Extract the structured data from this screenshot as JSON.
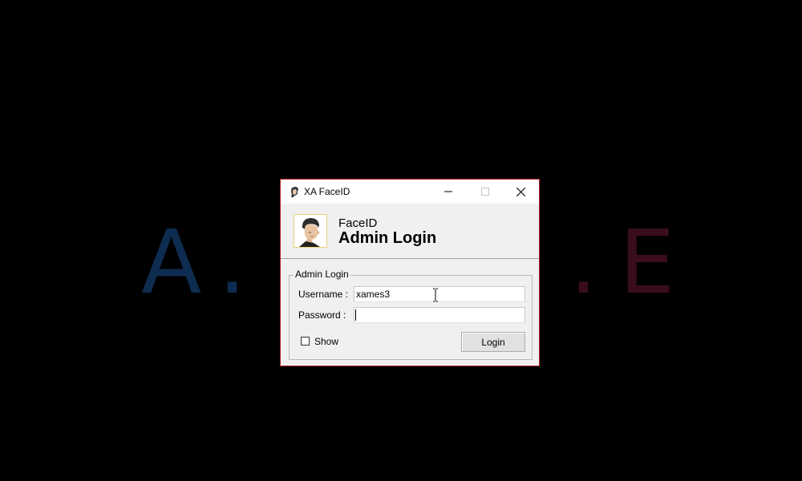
{
  "background": {
    "letters": [
      "A",
      ".",
      ".",
      "E"
    ],
    "left_color": "#0e2c4f",
    "right_color": "#3a0d1a"
  },
  "window": {
    "title": "XA FaceID",
    "border_color": "#b82327",
    "controls": {
      "minimize_icon": "minimize-icon",
      "maximize_icon": "maximize-icon",
      "close_icon": "close-icon"
    }
  },
  "header": {
    "subtitle": "FaceID",
    "title": "Admin Login",
    "avatar_icon": "user-portrait-icon"
  },
  "login_group": {
    "legend": "Admin Login",
    "username_label": "Username :",
    "username_value": "xames3",
    "password_label": "Password :",
    "password_value": "",
    "show_label": "Show",
    "show_checked": false,
    "login_button": "Login"
  }
}
